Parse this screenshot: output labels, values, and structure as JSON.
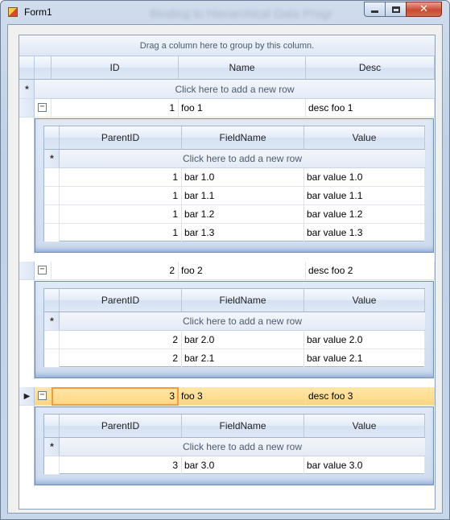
{
  "window": {
    "title": "Form1",
    "background_title": "Binding to Hierarchical Data Progr"
  },
  "grid": {
    "group_panel_text": "Drag a column here to group by this column.",
    "columns": [
      "ID",
      "Name",
      "Desc"
    ],
    "new_row_text": "Click here to add a new row",
    "child_columns": [
      "ParentID",
      "FieldName",
      "Value"
    ],
    "parents": [
      {
        "id": "1",
        "name": "foo 1",
        "desc": "desc foo 1",
        "expanded": true,
        "current": false,
        "children": [
          {
            "parent_id": "1",
            "field_name": "bar 1.0",
            "value": "bar value 1.0"
          },
          {
            "parent_id": "1",
            "field_name": "bar 1.1",
            "value": "bar value 1.1"
          },
          {
            "parent_id": "1",
            "field_name": "bar 1.2",
            "value": "bar value 1.2"
          },
          {
            "parent_id": "1",
            "field_name": "bar 1.3",
            "value": "bar value 1.3"
          }
        ]
      },
      {
        "id": "2",
        "name": "foo 2",
        "desc": "desc foo 2",
        "expanded": true,
        "current": false,
        "children": [
          {
            "parent_id": "2",
            "field_name": "bar 2.0",
            "value": "bar value 2.0"
          },
          {
            "parent_id": "2",
            "field_name": "bar 2.1",
            "value": "bar value 2.1"
          }
        ]
      },
      {
        "id": "3",
        "name": "foo 3",
        "desc": "desc foo 3",
        "expanded": true,
        "current": true,
        "children": [
          {
            "parent_id": "3",
            "field_name": "bar 3.0",
            "value": "bar value 3.0"
          }
        ]
      }
    ]
  },
  "icons": {
    "new_row_marker": "*",
    "collapse": "−",
    "current_row": "▶"
  }
}
